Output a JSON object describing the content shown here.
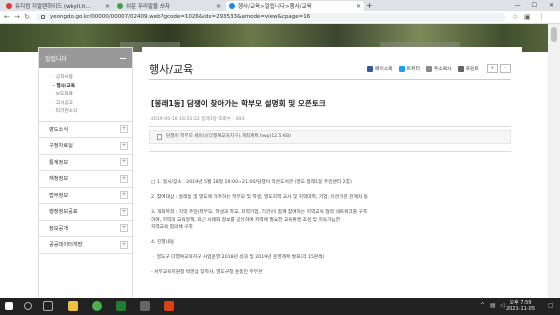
{
  "browser": {
    "tabs": [
      {
        "label": "유지컴 지알렌하이드 (wkyll.it...",
        "icon_color": "#e53935"
      },
      {
        "label": "쉬운 우리말을 쓰자",
        "icon_color": "#43a047"
      },
      {
        "label": "행사/교육>알립니다>행사/교육",
        "icon_color": "#1e88e5"
      }
    ],
    "new_tab": "+",
    "url": "yeongdo.go.kr/00000/00007/02409.web?gcode=1026&idx=293533&amode=view&cpage=16",
    "window_controls": [
      "—",
      "☐",
      "✕"
    ]
  },
  "sidebar": {
    "header": "알립니다",
    "sub_items": [
      {
        "label": "· 공지사항",
        "selected": false
      },
      {
        "label": "· 행사/교육",
        "selected": true
      },
      {
        "label": "· 보도자료",
        "selected": false
      },
      {
        "label": "· 고시공고",
        "selected": false
      },
      {
        "label": "· 타기관소식",
        "selected": false
      }
    ],
    "categories": [
      "영도소식",
      "구정자료실",
      "통계정보",
      "재정정보",
      "법무정보",
      "행정정보공표",
      "정보공개",
      "공공데이터개방"
    ]
  },
  "page": {
    "title": "행사/교육",
    "shares": [
      {
        "label": "페이스북",
        "color": "#3b5998"
      },
      {
        "label": "트위터",
        "color": "#1da1f2"
      },
      {
        "label": "주소복사",
        "color": "#888888"
      }
    ],
    "print_label": "프린트",
    "zoom_buttons": [
      "+",
      "-"
    ]
  },
  "post": {
    "title": "[봉래1동] 담쟁이 찾아가는 학부모 설명회 및 오픈토크",
    "meta": "2019-05-16 16:02:22    봉래1동    조회수 : 493",
    "attachment": "담쟁이 학부모 세미나(다행복교육지구).개최계획.hwp(12.5 KB)",
    "body_lines": [
      "□ 1. 일시/장소 : 2019년 5월 18일 19:00~21:00/담쟁이 작은도서관 (영도 봉래1동 주민센터 2층)",
      "",
      "    2. 참여대상 : 봉래동 및 영도에 거주하는 학부모 및 학생, 영도지역 교사 및 지역대학, 기업, 유관기관 관계자 등",
      "",
      "    3. 개최목적 : 지역 주민(학부모, 학생과 학교, 지역기업, 기관)이 함께 참여하는 지역교육 협력 네트워크를 구축",
      "                  하여, 지역의 교육정책, 최근 사례와 정보를 공유하여 지역에 필요한 교육환경 조성 및 지속가능한",
      "                  지역교육 협의체 구축",
      "",
      "    4. 진행내용",
      "",
      "        ㆍ 영도구 다행복교육지구 사업운영 2018년 성과 및 2019년 운영계획 발표(각 15분씩)",
      "",
      "        - 서부교육지원청 박영상 장학사, 영도구청 운동민 주무관"
    ]
  },
  "taskbar": {
    "time": "오후 7:59",
    "date": "2021-11-05"
  }
}
